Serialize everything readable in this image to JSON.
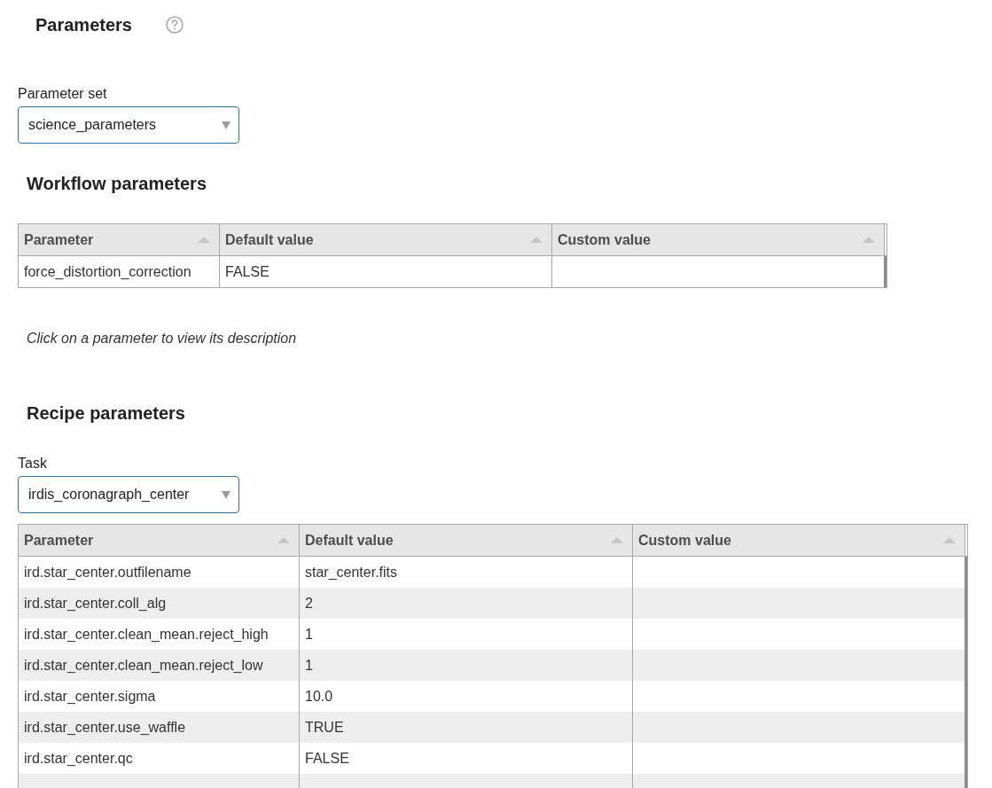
{
  "header": {
    "title": "Parameters"
  },
  "parameter_set": {
    "label": "Parameter set",
    "value": "science_parameters"
  },
  "workflow_parameters": {
    "title": "Workflow parameters",
    "table": {
      "columns": [
        "Parameter",
        "Default value",
        "Custom value"
      ],
      "rows": [
        {
          "cells": [
            "force_distortion_correction",
            "FALSE"
          ]
        }
      ]
    }
  },
  "hint": "Click on a parameter to view its description",
  "recipe_parameters": {
    "title": "Recipe parameters",
    "task": {
      "label": "Task",
      "value": "irdis_coronagraph_center"
    },
    "table": {
      "columns": [
        "Parameter",
        "Default value",
        "Custom value"
      ],
      "rows": [
        {
          "cells": [
            "ird.star_center.outfilename",
            "star_center.fits"
          ]
        },
        {
          "cells": [
            "ird.star_center.coll_alg",
            "2"
          ]
        },
        {
          "cells": [
            "ird.star_center.clean_mean.reject_high",
            "1"
          ]
        },
        {
          "cells": [
            "ird.star_center.clean_mean.reject_low",
            "1"
          ]
        },
        {
          "cells": [
            "ird.star_center.sigma",
            "10.0"
          ]
        },
        {
          "cells": [
            "ird.star_center.use_waffle",
            "TRUE"
          ]
        },
        {
          "cells": [
            "ird.star_center.qc",
            "FALSE"
          ]
        }
      ]
    }
  }
}
